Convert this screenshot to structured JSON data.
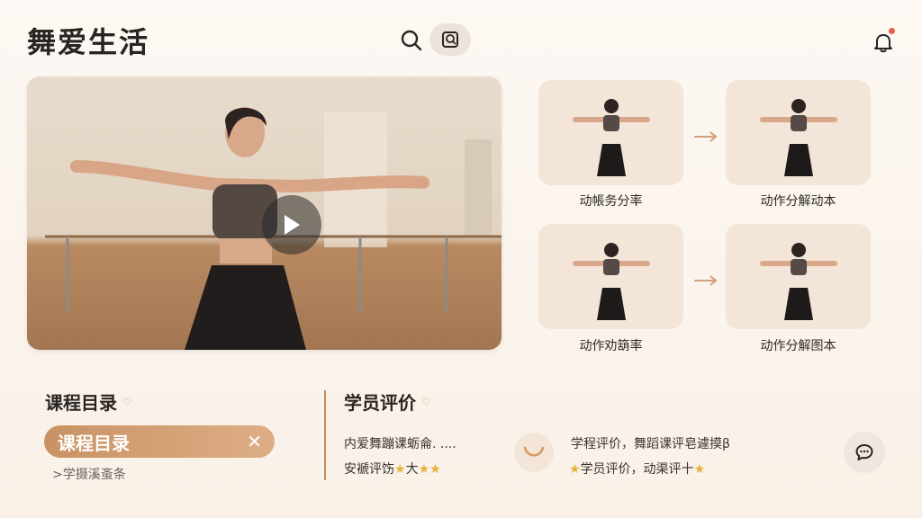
{
  "header": {
    "brand": "舞爱生活",
    "search_icon": "search-icon",
    "scan_icon": "scan-icon",
    "bell_icon": "bell-icon"
  },
  "video": {
    "play_icon": "play-icon"
  },
  "steps": [
    {
      "label": "动帳务分率"
    },
    {
      "label": "动作分解动本"
    },
    {
      "label": "动作劝箶率"
    },
    {
      "label": "动作分解图本"
    }
  ],
  "catalog": {
    "title": "课程目录",
    "pill_label": "课程目录",
    "close_icon": "close-icon",
    "sub_link": ">学摄溪蚉条"
  },
  "reviews": {
    "title": "学员评价",
    "left_line1": "内爱舞蹦课蛎侖.  ....",
    "left_line2_prefix": "安褫评饬",
    "left_line2_middle": "大",
    "right_line1": "学程评价，舞蹈课评皂遽摸β",
    "right_line2_text": "学员评价，动渠评十",
    "chat_icon": "chat-icon",
    "smile_icon": "smile-icon"
  },
  "colors": {
    "accent": "#c99264",
    "star": "#e5b33b",
    "notification": "#e85b4a"
  }
}
